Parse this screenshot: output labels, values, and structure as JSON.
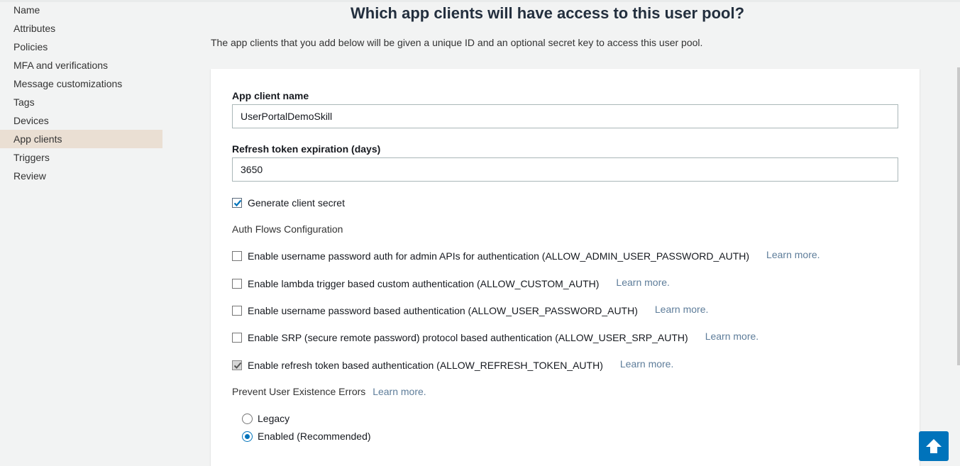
{
  "sidebar": {
    "items": [
      {
        "label": "Name"
      },
      {
        "label": "Attributes"
      },
      {
        "label": "Policies"
      },
      {
        "label": "MFA and verifications"
      },
      {
        "label": "Message customizations"
      },
      {
        "label": "Tags"
      },
      {
        "label": "Devices"
      },
      {
        "label": "App clients",
        "active": true
      },
      {
        "label": "Triggers"
      },
      {
        "label": "Review"
      }
    ]
  },
  "main": {
    "heading": "Which app clients will have access to this user pool?",
    "subtitle": "The app clients that you add below will be given a unique ID and an optional secret key to access this user pool."
  },
  "form": {
    "client_name_label": "App client name",
    "client_name_value": "UserPortalDemoSkill",
    "refresh_label": "Refresh token expiration (days)",
    "refresh_value": "3650",
    "generate_secret_label": "Generate client secret",
    "generate_secret_checked": true,
    "auth_flows_title": "Auth Flows Configuration",
    "auth_flows": [
      {
        "label": "Enable username password auth for admin APIs for authentication (ALLOW_ADMIN_USER_PASSWORD_AUTH)",
        "checked": false,
        "learn_more": "Learn more."
      },
      {
        "label": "Enable lambda trigger based custom authentication (ALLOW_CUSTOM_AUTH)",
        "checked": false,
        "learn_more": "Learn more."
      },
      {
        "label": "Enable username password based authentication (ALLOW_USER_PASSWORD_AUTH)",
        "checked": false,
        "learn_more": "Learn more."
      },
      {
        "label": "Enable SRP (secure remote password) protocol based authentication (ALLOW_USER_SRP_AUTH)",
        "checked": false,
        "learn_more": "Learn more."
      },
      {
        "label": "Enable refresh token based authentication (ALLOW_REFRESH_TOKEN_AUTH)",
        "checked": true,
        "disabled": true,
        "learn_more": "Learn more."
      }
    ],
    "prevent_errors_title": "Prevent User Existence Errors",
    "prevent_errors_learn": "Learn more.",
    "options": [
      {
        "label": "Legacy",
        "selected": false
      },
      {
        "label": "Enabled (Recommended)",
        "selected": true
      }
    ]
  },
  "icons": {
    "scroll_top": "arrow-up-icon",
    "checkmark": "checkmark-icon"
  },
  "colors": {
    "accent": "#0073bb",
    "active_nav": "#eadfd3",
    "link": "#5e7d9a"
  }
}
